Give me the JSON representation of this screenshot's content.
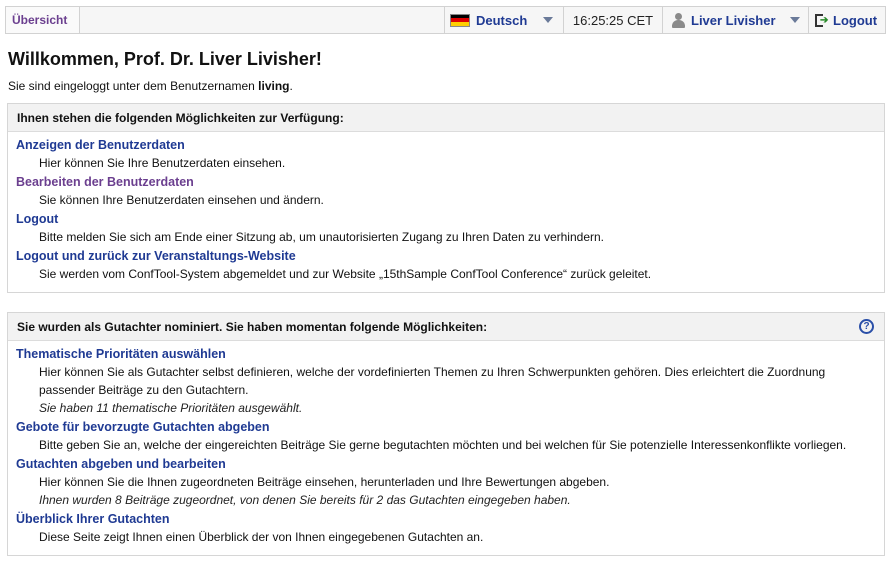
{
  "topbar": {
    "overview_label": "Übersicht",
    "language_label": "Deutsch",
    "time": "16:25:25 CET",
    "user_label": "Liver Livisher",
    "logout_label": "Logout",
    "flag_colors": [
      "#000000",
      "#dd0000",
      "#ffce00"
    ]
  },
  "header": {
    "welcome": "Willkommen, Prof. Dr. Liver Livisher!",
    "loggedin_prefix": "Sie sind eingeloggt unter dem Benutzernamen ",
    "username": "living",
    "loggedin_suffix": "."
  },
  "panel1": {
    "title": "Ihnen stehen die folgenden Möglichkeiten zur Verfügung:",
    "items": [
      {
        "title": "Anzeigen der Benutzerdaten",
        "desc": "Hier können Sie Ihre Benutzerdaten einsehen."
      },
      {
        "title": "Bearbeiten der Benutzerdaten",
        "desc": "Sie können Ihre Benutzerdaten einsehen und ändern."
      },
      {
        "title": "Logout",
        "desc": "Bitte melden Sie sich am Ende einer Sitzung ab, um unautorisierten Zugang zu Ihren Daten zu verhindern."
      },
      {
        "title": "Logout und zurück zur Veranstaltungs-Website",
        "desc": "Sie werden vom ConfTool-System abgemeldet und zur Website „15thSample ConfTool Conference“ zurück geleitet."
      }
    ]
  },
  "panel2": {
    "title": "Sie wurden als Gutachter nominiert. Sie haben momentan folgende Möglichkeiten:",
    "help_symbol": "?",
    "items": [
      {
        "title": "Thematische Prioritäten auswählen",
        "desc": "Hier können Sie als Gutachter selbst definieren, welche der vordefinierten Themen zu Ihren Schwerpunkten gehören. Dies erleichtert die Zuordnung passender Beiträge zu den Gutachtern.",
        "note": "Sie haben 11 thematische Prioritäten ausgewählt."
      },
      {
        "title": "Gebote für bevorzugte Gutachten abgeben",
        "desc": "Bitte geben Sie an, welche der eingereichten Beiträge Sie gerne begutachten möchten und bei welchen für Sie potenzielle Interessenkonflikte vorliegen."
      },
      {
        "title": "Gutachten abgeben und bearbeiten",
        "desc": "Hier können Sie die Ihnen zugeordneten Beiträge einsehen, herunterladen und Ihre Bewertungen abgeben.",
        "note": "Ihnen wurden 8 Beiträge zugeordnet, von denen Sie bereits für 2 das Gutachten eingegeben haben."
      },
      {
        "title": "Überblick Ihrer Gutachten",
        "desc": "Diese Seite zeigt Ihnen einen Überblick der von Ihnen eingegebenen Gutachten an."
      }
    ]
  }
}
